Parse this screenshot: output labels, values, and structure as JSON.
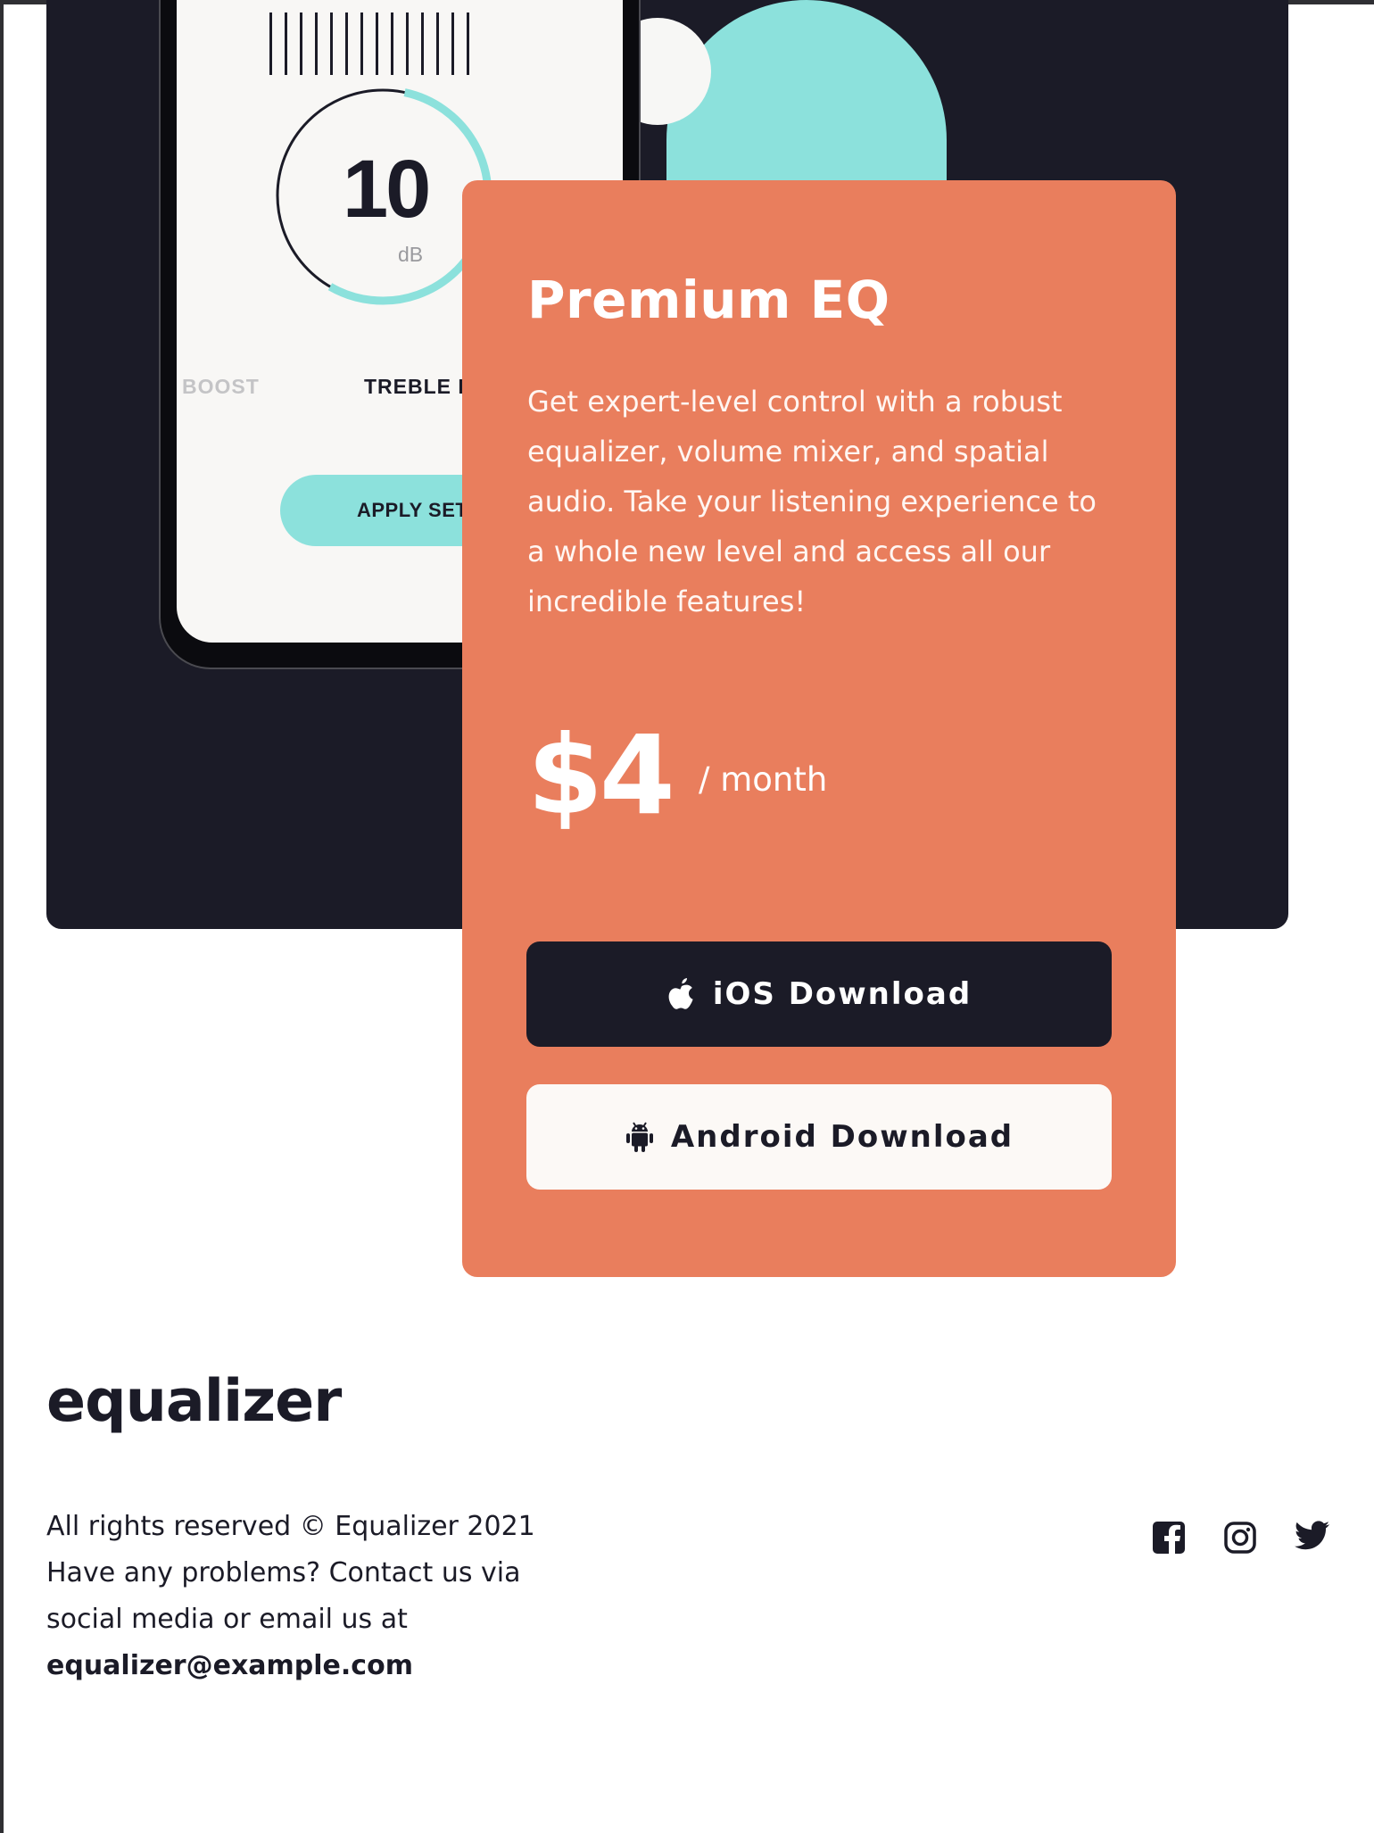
{
  "phone": {
    "gauge_value": "10",
    "gauge_unit": "dB",
    "gauge_level": 0.3,
    "bass_label": "BOOST",
    "treble_label": "TREBLE BOOST",
    "apply_label": "APPLY SETTINGS"
  },
  "card": {
    "title": "Premium EQ",
    "description": "Get expert-level control with a robust equalizer, volume mixer, and spatial audio. Take your listening experience to a whole new level and access all our incredible features!",
    "price": "$4",
    "period": "/ month",
    "ios_button": "iOS Download",
    "android_button": "Android Download"
  },
  "footer": {
    "logo": "equalizer",
    "rights": "All rights reserved © Equalizer 2021",
    "contact": "Have any problems? Contact us via social media or email us at",
    "email": "equalizer@example.com",
    "social_icons": [
      "facebook-icon",
      "instagram-icon",
      "twitter-icon"
    ]
  },
  "colors": {
    "dark": "#1b1b27",
    "teal": "#8ce1dc",
    "coral": "#e97e5d",
    "cream": "#fcf9f6"
  }
}
